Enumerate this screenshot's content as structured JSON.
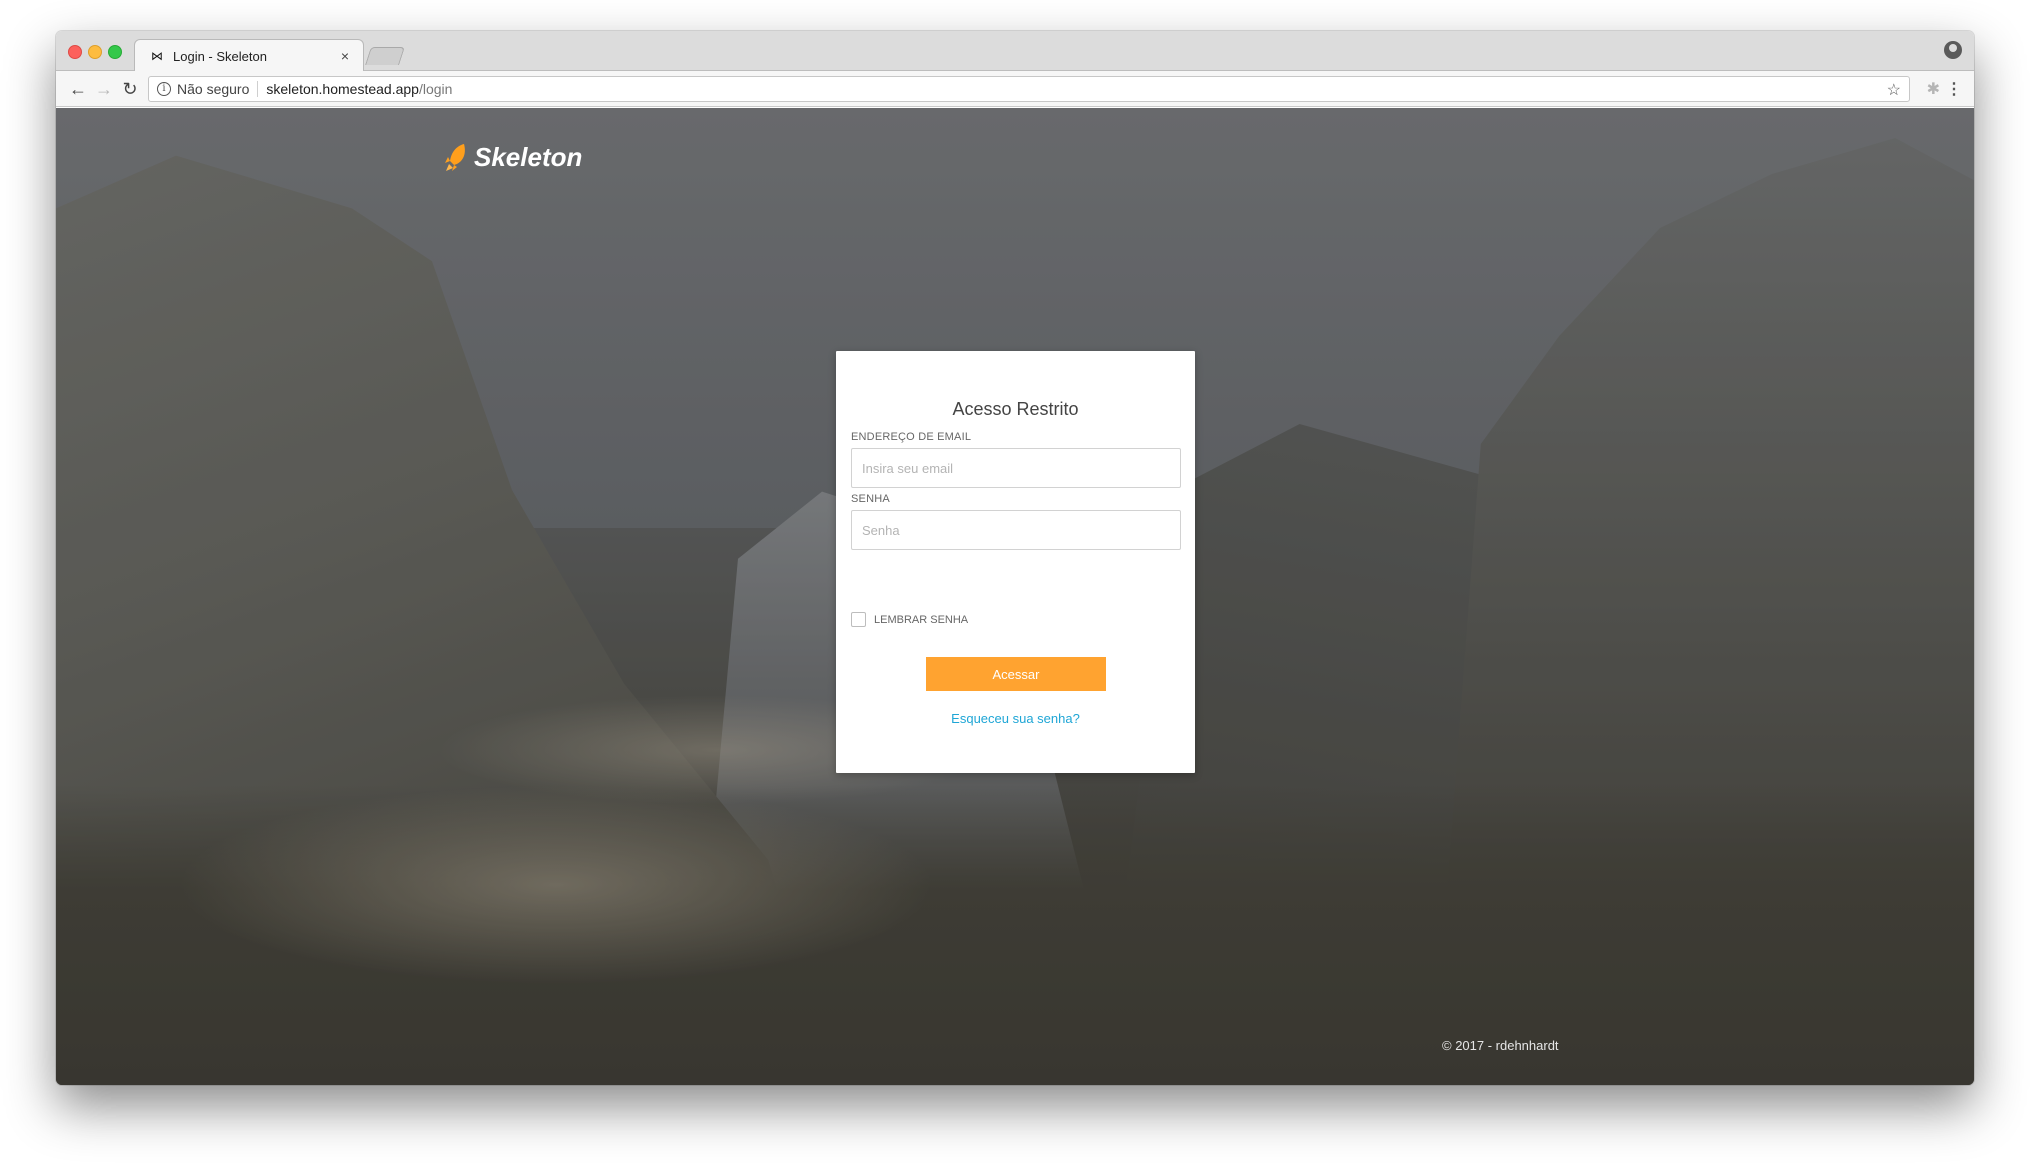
{
  "browser": {
    "tab": {
      "favicon": "bow-tie-icon",
      "title": "Login - Skeleton",
      "close_symbol": "×"
    },
    "omnibox": {
      "security_label": "Não seguro",
      "url_host": "skeleton.homestead.app",
      "url_path": "/login"
    }
  },
  "page": {
    "brand": "Skeleton",
    "brand_color": "#ff9f1c",
    "card": {
      "title": "Acesso Restrito",
      "email_label": "ENDEREÇO DE EMAIL",
      "email_placeholder": "Insira seu email",
      "password_label": "SENHA",
      "password_placeholder": "Senha",
      "remember_label": "LEMBRAR SENHA",
      "submit_label": "Acessar",
      "forgot_link": "Esqueceu sua senha?"
    },
    "footer": "© 2017 - rdehnhardt",
    "accent_color": "#ffa330",
    "link_color": "#1fa6d6"
  }
}
